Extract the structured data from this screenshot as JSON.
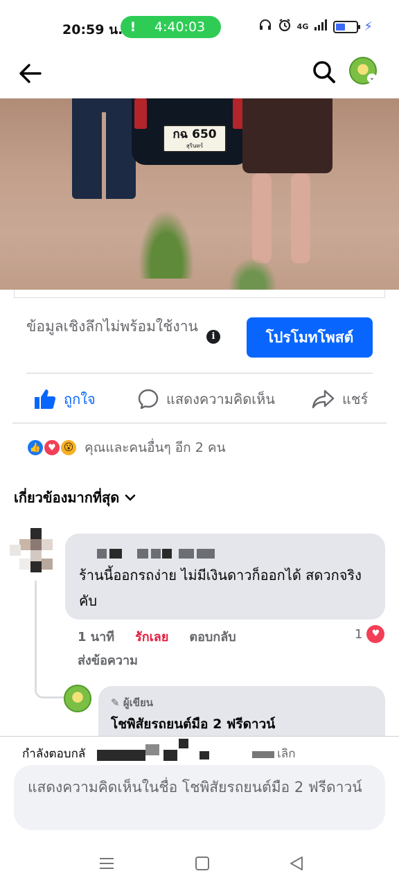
{
  "status_bar": {
    "time": "20:59 น.",
    "call_duration": "4:40:03",
    "call_indicator": "!",
    "network": "4G"
  },
  "header": {
    "back_icon": "arrow-left-icon",
    "search_icon": "search-icon"
  },
  "post_image": {
    "plate_number": "กฉ 650",
    "plate_province": "สุรินทร์"
  },
  "insights": {
    "text": "ข้อมูลเชิงลึกไม่พร้อมใช้งาน",
    "info_icon": "i",
    "promote_label": "โปรโมทโพสต์"
  },
  "actions": {
    "like": "ถูกใจ",
    "comment": "แสดงความคิดเห็น",
    "share": "แชร์"
  },
  "reactions": {
    "summary": "คุณและคนอื่นๆ อีก 2 คน"
  },
  "comments_sort": {
    "label": "เกี่ยวข้องมากที่สุด"
  },
  "comment": {
    "text": "ร้านนี้ออกรถง่าย ไม่มีเงินดาวก็ออกได้ สดวกจริงคับ",
    "time": "1 นาที",
    "love_label": "รักเลย",
    "reply_label": "ตอบกลับ",
    "message_label": "ส่งข้อความ",
    "reaction_count": "1"
  },
  "reply": {
    "badge": "ผู้เขียน",
    "author": "โชพิสัยรถยนต์มือ 2 ฟรีดาวน์"
  },
  "composer": {
    "replying_label": "กำลังตอบกลั",
    "cancel_label": "เลิก",
    "placeholder": "แสดงความคิดเห็นในชื่อ โชพิสัยรถยนต์มือ 2 ฟรีดาวน์"
  },
  "colors": {
    "accent": "#0866ff",
    "love": "#e41e3f",
    "call_green": "#2ecc55"
  }
}
